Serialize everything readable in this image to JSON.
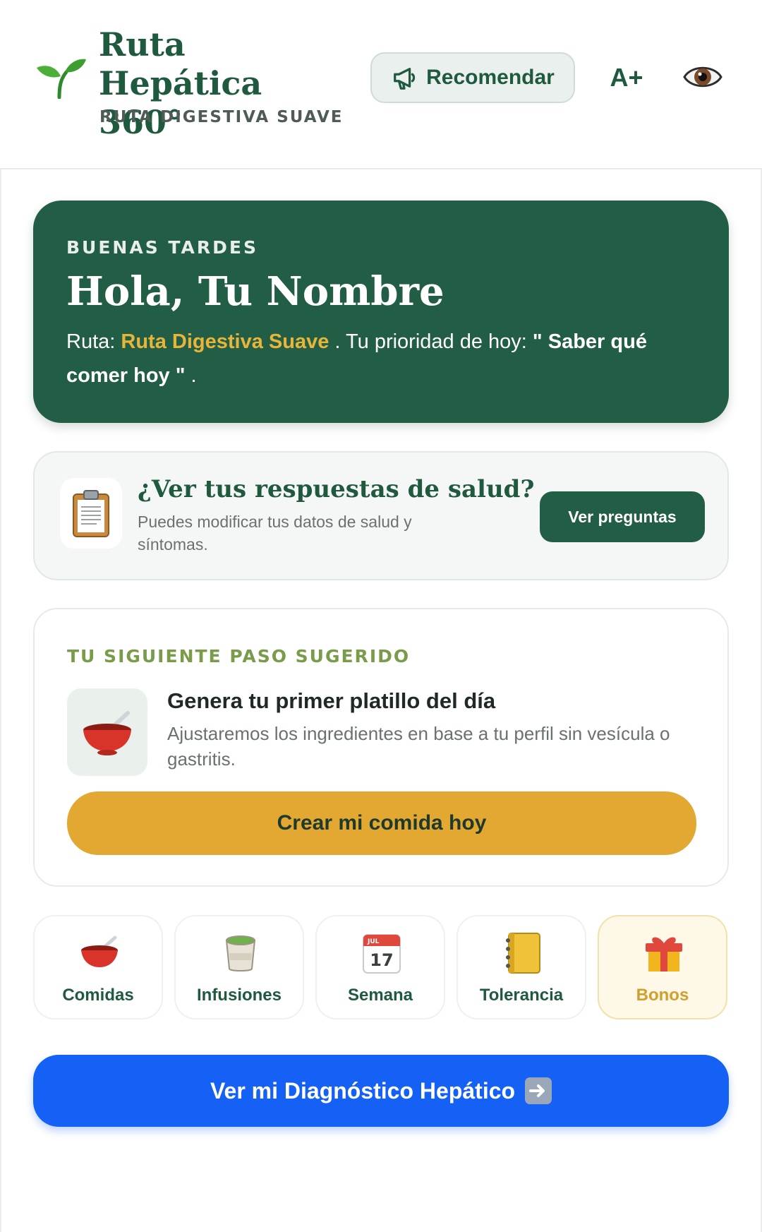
{
  "header": {
    "brand_title": "Ruta Hepática 360°",
    "brand_subtitle": "RUTA DIGESTIVA SUAVE",
    "recommend_label": "Recomendar",
    "font_size_label": "A+",
    "logo_icon": "seedling-icon",
    "eye_icon": "eye-icon"
  },
  "hero": {
    "greeting": "BUENAS TARDES",
    "title": "Hola, Tu Nombre",
    "route_prefix": "Ruta:",
    "route_name": "Ruta Digestiva Suave",
    "priority_prefix": ". Tu prioridad de hoy:",
    "priority_value": "\" Saber qué comer hoy \"",
    "suffix": "."
  },
  "health_card": {
    "icon": "clipboard-icon",
    "title": "¿Ver tus respuestas de salud?",
    "description": "Puedes modificar tus datos de salud y síntomas.",
    "button_label": "Ver preguntas"
  },
  "next_step": {
    "label": "TU SIGUIENTE PASO SUGERIDO",
    "icon": "bowl-icon",
    "title": "Genera tu primer platillo del día",
    "description": "Ajustaremos los ingredientes en base a tu perfil sin vesícula o gastritis.",
    "button_label": "Crear mi comida hoy"
  },
  "tiles": [
    {
      "label": "Comidas",
      "icon": "bowl-icon"
    },
    {
      "label": "Infusiones",
      "icon": "tea-cup-icon"
    },
    {
      "label": "Semana",
      "icon": "calendar-icon",
      "calendar_month": "JUL",
      "calendar_day": "17"
    },
    {
      "label": "Tolerancia",
      "icon": "notebook-icon"
    },
    {
      "label": "Bonos",
      "icon": "gift-icon",
      "active": true
    }
  ],
  "diagnostic_button": {
    "label": "Ver mi Diagnóstico Hepático",
    "icon": "right-arrow-icon"
  },
  "colors": {
    "primary_green": "#225d45",
    "accent_gold": "#e3a832",
    "action_blue": "#1560f5"
  }
}
